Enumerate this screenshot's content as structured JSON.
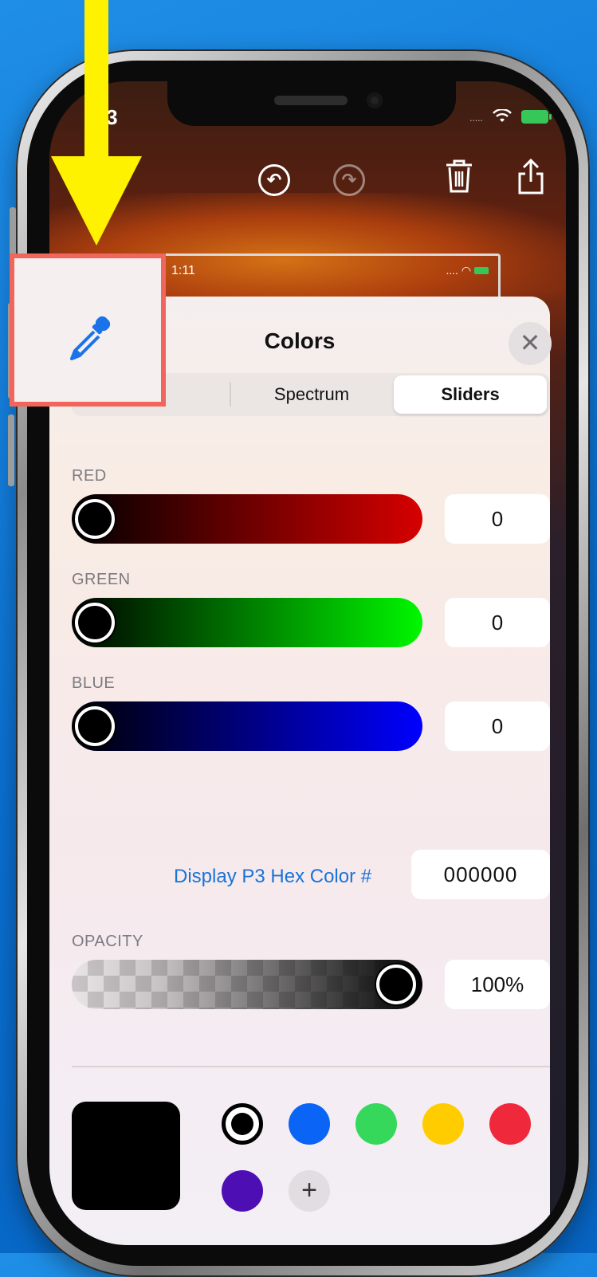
{
  "status_bar": {
    "time": ":23",
    "signal_dots": "....."
  },
  "embedded_screenshot": {
    "time": "1:11",
    "signal_dots": "...."
  },
  "toolbar": {
    "undo_icon": "undo-icon",
    "redo_icon": "redo-icon",
    "trash_icon": "trash-icon",
    "share_icon": "share-icon"
  },
  "sheet": {
    "title": "Colors",
    "close_glyph": "✕",
    "tabs": [
      {
        "label": "",
        "selected": false
      },
      {
        "label": "Spectrum",
        "selected": false
      },
      {
        "label": "Sliders",
        "selected": true
      }
    ],
    "sliders": [
      {
        "label": "RED",
        "value": "0",
        "level": 0,
        "color": "#d70000"
      },
      {
        "label": "GREEN",
        "value": "0",
        "level": 0,
        "color": "#00f700"
      },
      {
        "label": "BLUE",
        "value": "0",
        "level": 0,
        "color": "#0000ff"
      }
    ],
    "hex": {
      "label": "Display P3 Hex Color #",
      "value": "000000"
    },
    "opacity": {
      "label": "OPACITY",
      "value": "100%",
      "level": 1.0
    },
    "current_color": "#000000",
    "swatches": [
      "#000000",
      "#0a64f5",
      "#36d85c",
      "#ffcc00",
      "#f0283c",
      "#4d0fb4"
    ],
    "add_glyph": "+"
  },
  "annotations": {
    "arrow_color": "#fff200",
    "highlight_color": "#f0665c",
    "highlighted_tool": "eyedropper-icon"
  }
}
